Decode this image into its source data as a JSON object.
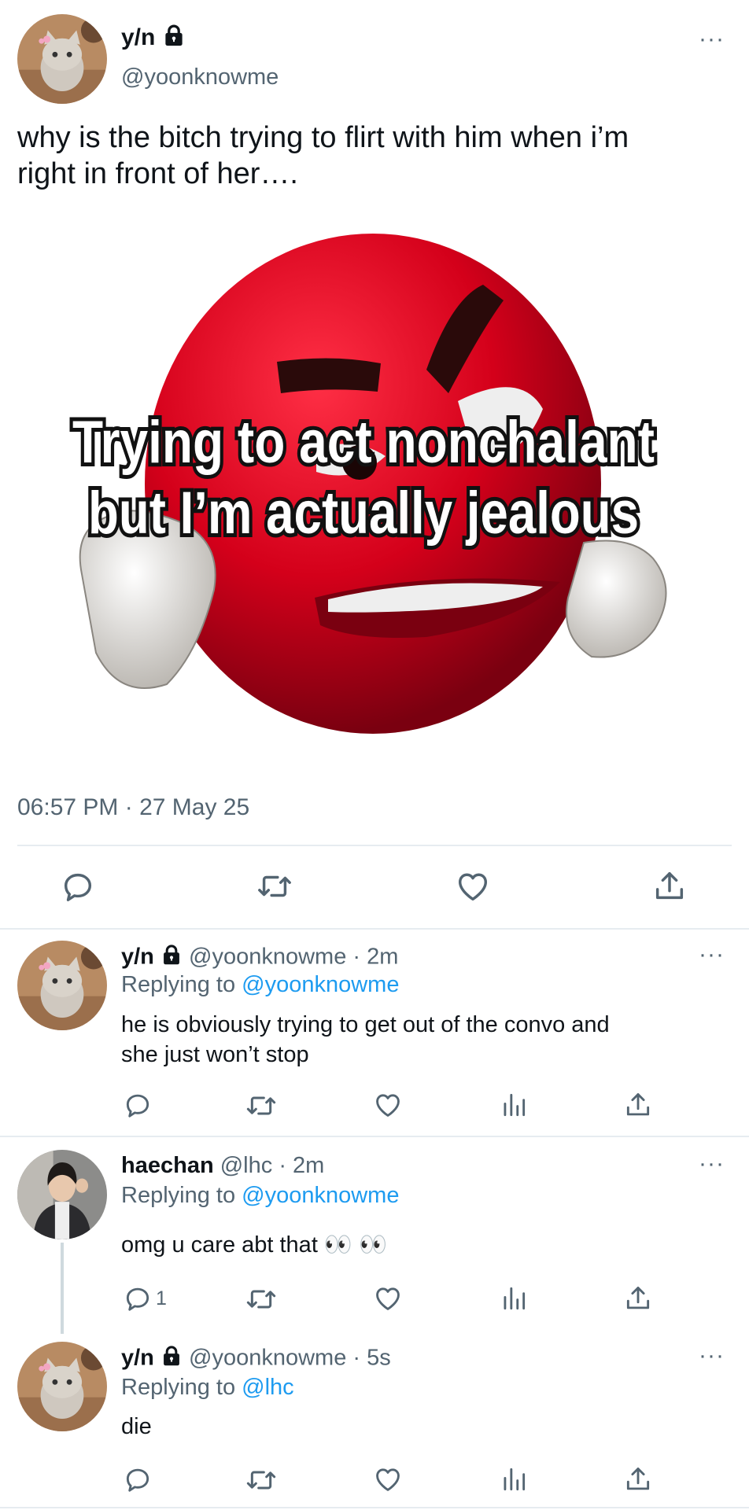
{
  "main_tweet": {
    "display_name": "y/n",
    "handle": "@yoonknowme",
    "text_line1": "why is the bitch trying to flirt with him when i’m",
    "text_line2": "right in front of her….",
    "image": {
      "caption_line1": "Trying to act nonchalant",
      "caption_line2": "but I’m actually jealous"
    },
    "timestamp": "06:57 PM · 27 May 25"
  },
  "replies": [
    {
      "display_name": "y/n",
      "handle": "@yoonknowme",
      "time": "· 2m",
      "replying_prefix": "Replying to ",
      "replying_to": "@yoonknowme",
      "text_line1": "he is obviously trying to get out of the convo and",
      "text_line2": "she just won’t stop",
      "reply_count": ""
    },
    {
      "display_name": "haechan",
      "handle": "@lhc",
      "time": "· 2m",
      "replying_prefix": "Replying to ",
      "replying_to": "@yoonknowme",
      "text_line1": "omg u care abt that 👀 👀",
      "reply_count": "1"
    },
    {
      "display_name": "y/n",
      "handle": "@yoonknowme",
      "time": "· 5s",
      "replying_prefix": "Replying to ",
      "replying_to": "@lhc",
      "text_line1": "die",
      "reply_count": ""
    }
  ],
  "colors": {
    "accent": "#1d9bf0",
    "muted": "#536471",
    "divider": "#e6ecf0",
    "emoji_red": "#d8001c"
  },
  "icons": [
    "lock-icon",
    "more-icon",
    "reply-icon",
    "retweet-icon",
    "like-icon",
    "share-icon",
    "views-icon"
  ]
}
